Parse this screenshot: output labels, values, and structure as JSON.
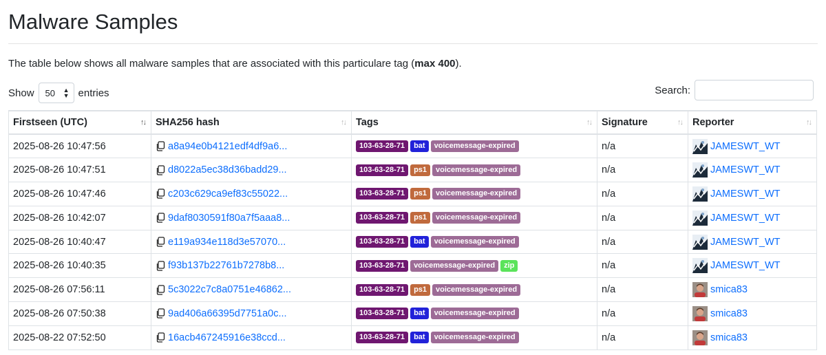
{
  "page": {
    "title": "Malware Samples",
    "intro_prefix": "The table below shows all malware samples that are associated with this particulare tag (",
    "intro_bold": "max 400",
    "intro_suffix": ")."
  },
  "controls": {
    "show_label": "Show",
    "entries_value": "50",
    "entries_label": "entries",
    "search_label": "Search:",
    "search_value": ""
  },
  "table": {
    "columns": [
      "Firstseen (UTC)",
      "SHA256 hash",
      "Tags",
      "Signature",
      "Reporter"
    ],
    "rows": [
      {
        "date": "2025-08-26 10:47:56",
        "hash": "a8a94e0b4121edf4df9a6...",
        "tags": [
          {
            "text": "103-63-28-71",
            "color": "#6f1770"
          },
          {
            "text": "bat",
            "color": "#2222d9"
          },
          {
            "text": "voicemessage-expired",
            "color": "#9d6b96"
          }
        ],
        "signature": "n/a",
        "reporter": "JAMESWT_WT",
        "avatar": "jameswt"
      },
      {
        "date": "2025-08-26 10:47:51",
        "hash": "d8022a5ec38d36badd29...",
        "tags": [
          {
            "text": "103-63-28-71",
            "color": "#6f1770"
          },
          {
            "text": "ps1",
            "color": "#c06a3d"
          },
          {
            "text": "voicemessage-expired",
            "color": "#9d6b96"
          }
        ],
        "signature": "n/a",
        "reporter": "JAMESWT_WT",
        "avatar": "jameswt"
      },
      {
        "date": "2025-08-26 10:47:46",
        "hash": "c203c629ca9ef83c55022...",
        "tags": [
          {
            "text": "103-63-28-71",
            "color": "#6f1770"
          },
          {
            "text": "ps1",
            "color": "#c06a3d"
          },
          {
            "text": "voicemessage-expired",
            "color": "#9d6b96"
          }
        ],
        "signature": "n/a",
        "reporter": "JAMESWT_WT",
        "avatar": "jameswt"
      },
      {
        "date": "2025-08-26 10:42:07",
        "hash": "9daf8030591f80a7f5aaa8...",
        "tags": [
          {
            "text": "103-63-28-71",
            "color": "#6f1770"
          },
          {
            "text": "ps1",
            "color": "#c06a3d"
          },
          {
            "text": "voicemessage-expired",
            "color": "#9d6b96"
          }
        ],
        "signature": "n/a",
        "reporter": "JAMESWT_WT",
        "avatar": "jameswt"
      },
      {
        "date": "2025-08-26 10:40:47",
        "hash": "e119a934e118d3e57070...",
        "tags": [
          {
            "text": "103-63-28-71",
            "color": "#6f1770"
          },
          {
            "text": "bat",
            "color": "#2222d9"
          },
          {
            "text": "voicemessage-expired",
            "color": "#9d6b96"
          }
        ],
        "signature": "n/a",
        "reporter": "JAMESWT_WT",
        "avatar": "jameswt"
      },
      {
        "date": "2025-08-26 10:40:35",
        "hash": "f93b137b22761b7278b8...",
        "tags": [
          {
            "text": "103-63-28-71",
            "color": "#6f1770"
          },
          {
            "text": "voicemessage-expired",
            "color": "#9d6b96"
          },
          {
            "text": "zip",
            "color": "#5be35b"
          }
        ],
        "signature": "n/a",
        "reporter": "JAMESWT_WT",
        "avatar": "jameswt"
      },
      {
        "date": "2025-08-26 07:56:11",
        "hash": "5c3022c7c8a0751e46862...",
        "tags": [
          {
            "text": "103-63-28-71",
            "color": "#6f1770"
          },
          {
            "text": "ps1",
            "color": "#c06a3d"
          },
          {
            "text": "voicemessage-expired",
            "color": "#9d6b96"
          }
        ],
        "signature": "n/a",
        "reporter": "smica83",
        "avatar": "smica"
      },
      {
        "date": "2025-08-26 07:50:38",
        "hash": "9ad406a66395d7751a0c...",
        "tags": [
          {
            "text": "103-63-28-71",
            "color": "#6f1770"
          },
          {
            "text": "bat",
            "color": "#2222d9"
          },
          {
            "text": "voicemessage-expired",
            "color": "#9d6b96"
          }
        ],
        "signature": "n/a",
        "reporter": "smica83",
        "avatar": "smica"
      },
      {
        "date": "2025-08-22 07:52:50",
        "hash": "16acb467245916e38ccd...",
        "tags": [
          {
            "text": "103-63-28-71",
            "color": "#6f1770"
          },
          {
            "text": "bat",
            "color": "#2222d9"
          },
          {
            "text": "voicemessage-expired",
            "color": "#9d6b96"
          }
        ],
        "signature": "n/a",
        "reporter": "smica83",
        "avatar": "smica"
      }
    ]
  }
}
